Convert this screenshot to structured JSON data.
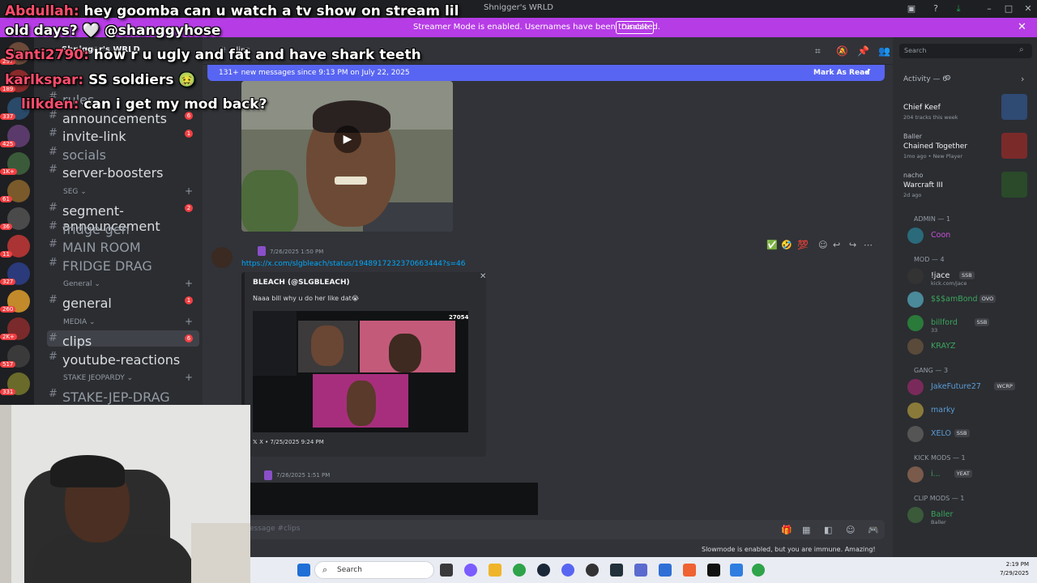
{
  "window": {
    "title": "Shnigger's WRLD",
    "controls": [
      "minimize-icon",
      "maximize-icon",
      "close-icon"
    ]
  },
  "streamer_banner": {
    "message": "Streamer Mode is enabled. Usernames have been truncated.",
    "disable_label": "Disable"
  },
  "server": {
    "name": "Shnigger's WRLD",
    "badges": [
      "297",
      "189",
      "337",
      "425",
      "1K+",
      "61",
      "36",
      "11",
      "327",
      "260",
      "2K+",
      "517",
      "331"
    ]
  },
  "channels": {
    "list": [
      {
        "name": "rules",
        "dim": true
      },
      {
        "name": "announcements",
        "count": "6"
      },
      {
        "name": "invite-link",
        "count": "1"
      },
      {
        "name": "socials",
        "dim": true
      },
      {
        "name": "server-boosters"
      }
    ],
    "categories": [
      {
        "name": "SEG",
        "items": [
          {
            "name": "segment-announcement",
            "count": "2"
          },
          {
            "name": "fridge-gen",
            "dim": true
          },
          {
            "name": "MAIN ROOM",
            "dim": true
          },
          {
            "name": "FRIDGE DRAG",
            "dim": true
          }
        ]
      },
      {
        "name": "General",
        "items": [
          {
            "name": "general",
            "count": "1"
          }
        ]
      },
      {
        "name": "MEDIA",
        "items": [
          {
            "name": "clips",
            "count": "6",
            "selected": true
          },
          {
            "name": "youtube-reactions"
          }
        ]
      },
      {
        "name": "STAKE JEOPARDY",
        "items": [
          {
            "name": "STAKE-JEP-DRAG (ETH)",
            "dim": true
          }
        ]
      }
    ]
  },
  "chat": {
    "channel_name": "clips",
    "new_messages": "131+ new messages since 9:13 PM on July 22, 2025",
    "mark_as_read": "Mark As Read",
    "messages": [
      {
        "timestamp": "7/26/2025 1:50 PM",
        "link": "https://x.com/slgbleach/status/1948917232370663444?s=46",
        "embed": {
          "author": "BLEACH (@SLGBLEACH)",
          "description": "Naaa bill why u do her like dat😭",
          "view_count": "27054",
          "footer": "X • 7/25/2025 9:24 PM"
        }
      },
      {
        "timestamp": "7/26/2025 1:51 PM"
      }
    ],
    "input_placeholder": "essage #clips",
    "slowmode": "Slowmode is enabled, but you are immune. Amazing!"
  },
  "search": {
    "placeholder": "Search"
  },
  "activity": {
    "header": "Activity — 6",
    "items": [
      {
        "title": "Chief Keef",
        "sub": "204 tracks this week",
        "color": "#2f4a73"
      },
      {
        "who": "Baller",
        "title": "Chained Together",
        "sub": "1mo ago • New Player",
        "color": "#7b2a2a"
      },
      {
        "who": "nacho",
        "title": "Warcraft III",
        "sub": "2d ago",
        "color": "#2a4a2a"
      }
    ]
  },
  "members": {
    "groups": [
      {
        "role": "ADMIN — 1",
        "members": [
          {
            "name": "Coon",
            "color": "#c94fd8"
          }
        ]
      },
      {
        "role": "MOD — 4",
        "members": [
          {
            "name": "!jace",
            "tag": "SSB",
            "status": "kick.com/jace",
            "color": "#f2f3f5"
          },
          {
            "name": "$$$amBond",
            "tag": "OVO",
            "color": "#3ba55c"
          },
          {
            "name": "billford",
            "tag": "SSB",
            "status": "33",
            "color": "#3ba55c"
          },
          {
            "name": "KRAYZ",
            "color": "#3ba55c"
          }
        ]
      },
      {
        "role": "GANG — 3",
        "members": [
          {
            "name": "JakeFuture27",
            "tag": "WCRP",
            "color": "#5b9bd5"
          },
          {
            "name": "marky",
            "color": "#5b9bd5"
          },
          {
            "name": "XELO",
            "tag": "SSB",
            "color": "#5b9bd5"
          }
        ]
      },
      {
        "role": "KICK MODS — 1",
        "members": [
          {
            "name": "i...",
            "tag": "YEAT",
            "color": "#3ba55c"
          }
        ]
      },
      {
        "role": "CLIP MODS — 1",
        "members": [
          {
            "name": "Baller",
            "status": "Baller",
            "color": "#3ba55c"
          }
        ]
      }
    ]
  },
  "overlay_chat": [
    {
      "name": "Abdullah:",
      "text": " hey goomba can u watch a tv show on stream lil"
    },
    {
      "name": "",
      "text": "old days? 🤍 @shanggyhose"
    },
    {
      "name": "Santi2790:",
      "text": " how r u ugly and fat and have shark teeth"
    },
    {
      "name": "karlkspar:",
      "text": " SS soldiers 🤢"
    },
    {
      "name": "lilkden:",
      "text": " can i get my mod back?"
    }
  ],
  "taskbar": {
    "search_placeholder": "Search",
    "time": "2:19 PM",
    "date": "7/29/2025"
  }
}
